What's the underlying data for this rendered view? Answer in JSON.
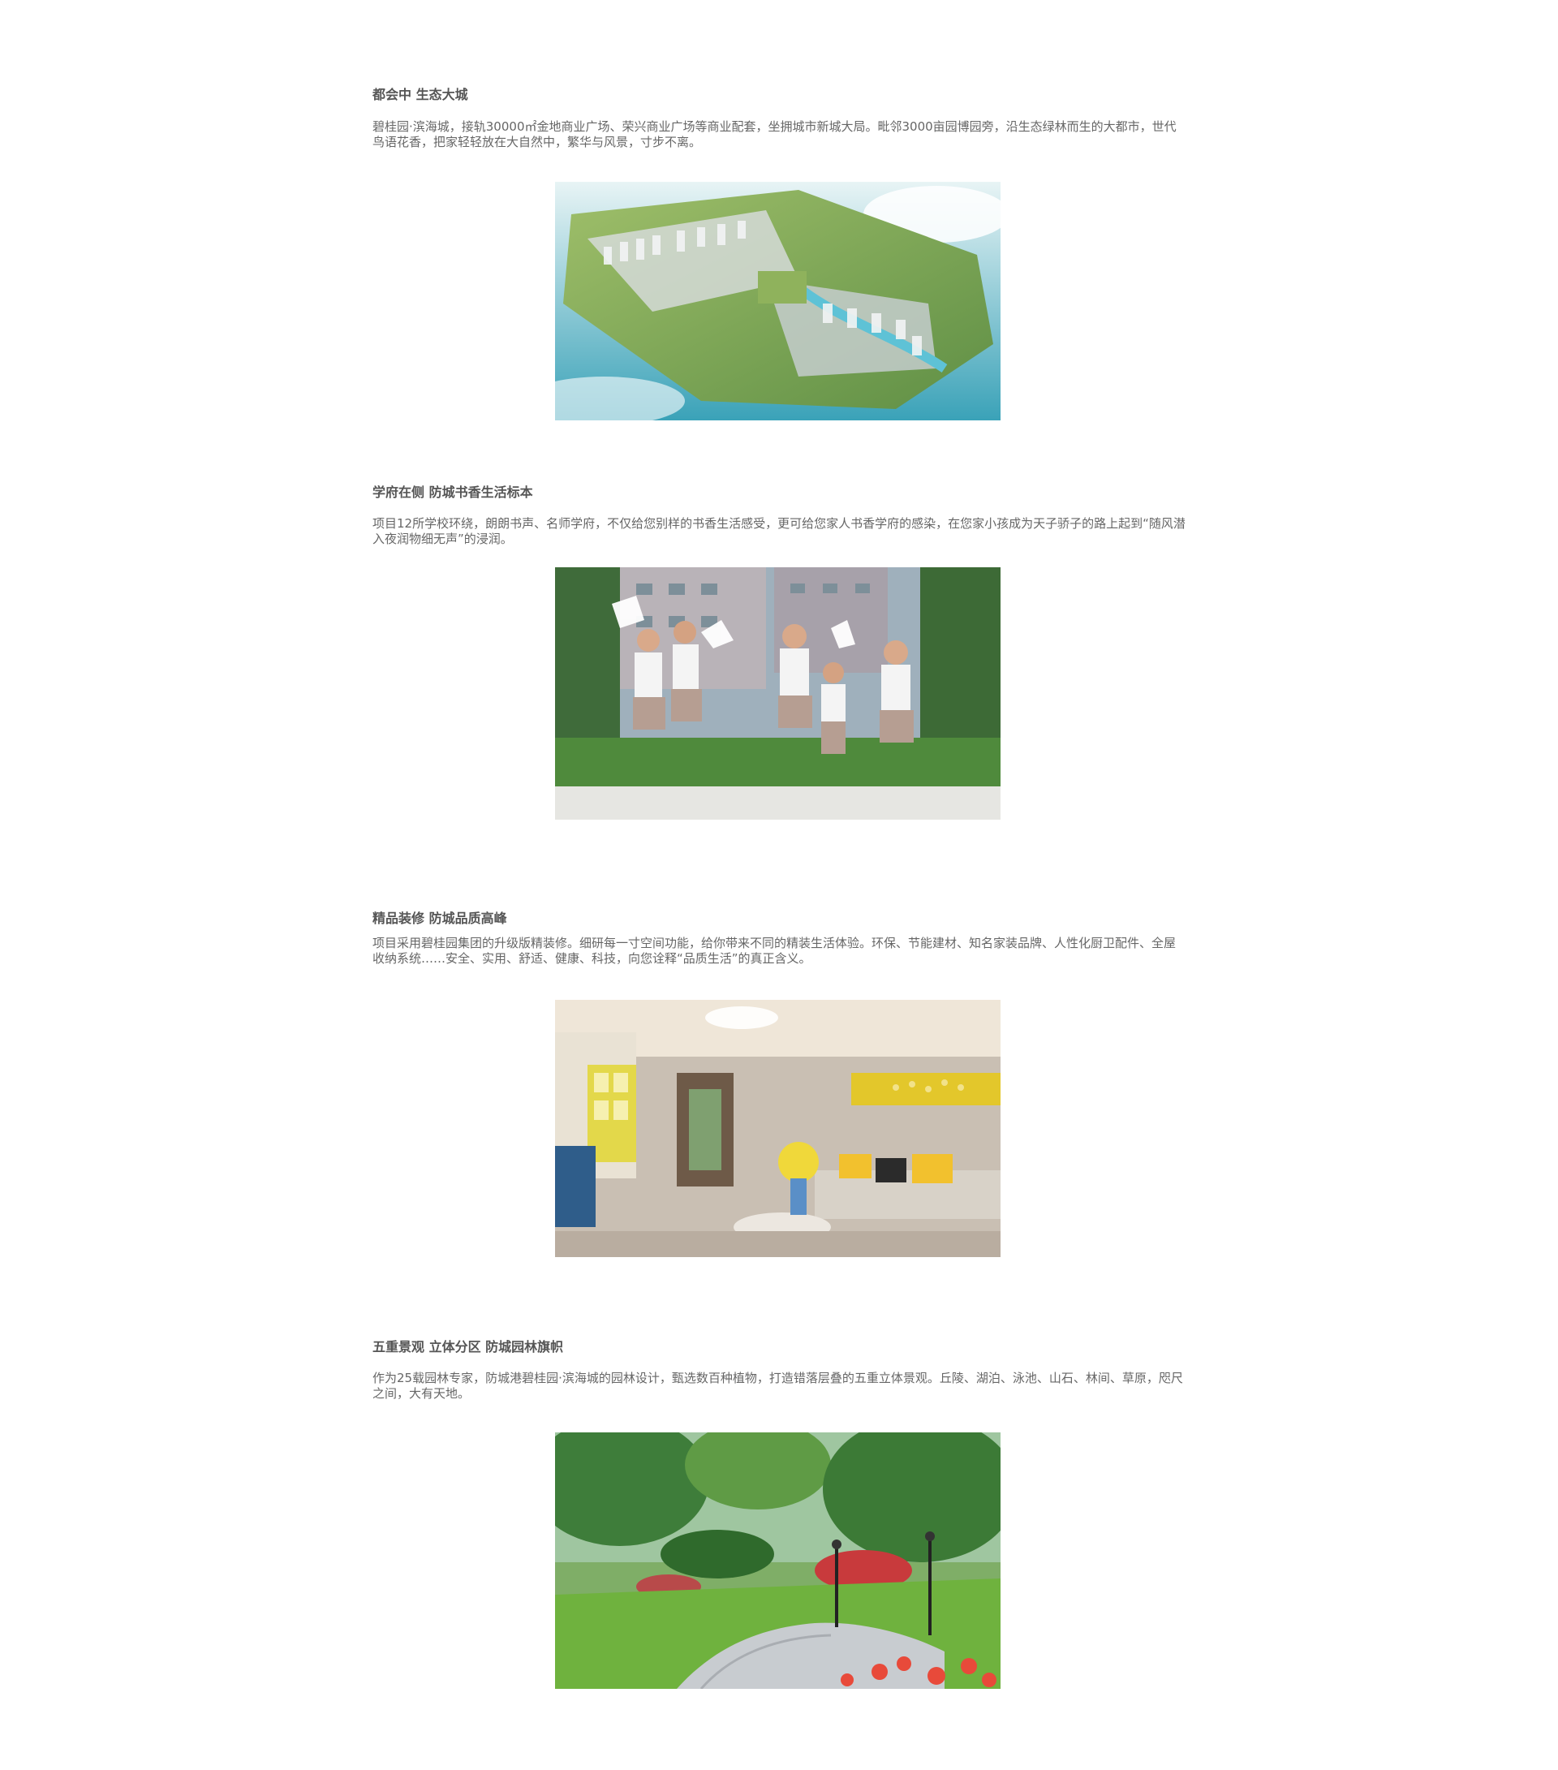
{
  "sections": [
    {
      "title": "都会中 生态大城",
      "body": "碧桂园·滨海城，接轨30000㎡金地商业广场、荣兴商业广场等商业配套，坐拥城市新城大局。毗邻3000亩园博园旁，沿生态绿林而生的大都市，世代鸟语花香，把家轻轻放在大自然中，繁华与风景，寸步不离。",
      "image_icon": "aerial-city-plan-illustration"
    },
    {
      "title": "学府在侧 防城书香生活标本",
      "body": "项目12所学校环绕，朗朗书声、名师学府，不仅给您别样的书香生活感受，更可给您家人书香学府的感染，在您家小孩成为天子骄子的路上起到“随风潜入夜润物细无声”的浸润。",
      "image_icon": "students-running-photo"
    },
    {
      "title": "精品装修 防城品质高峰",
      "body": "项目采用碧桂园集团的升级版精装修。细研每一寸空间功能，给你带来不同的精装生活体验。环保、节能建材、知名家装品牌、人性化厨卫配件、全屋收纳系统……安全、实用、舒适、健康、科技，向您诠释“品质生活”的真正含义。",
      "image_icon": "living-room-interior-photo"
    },
    {
      "title": "五重景观 立体分区 防城园林旗帜",
      "body": "作为25载园林专家，防城港碧桂园·滨海城的园林设计，甄选数百种植物，打造错落层叠的五重立体景观。丘陵、湖泊、泳池、山石、林间、草原，咫尺之间，大有天地。",
      "image_icon": "garden-landscape-photo"
    }
  ],
  "colors": {
    "background": "#ffffff",
    "title": "#555555",
    "body": "#666666"
  }
}
